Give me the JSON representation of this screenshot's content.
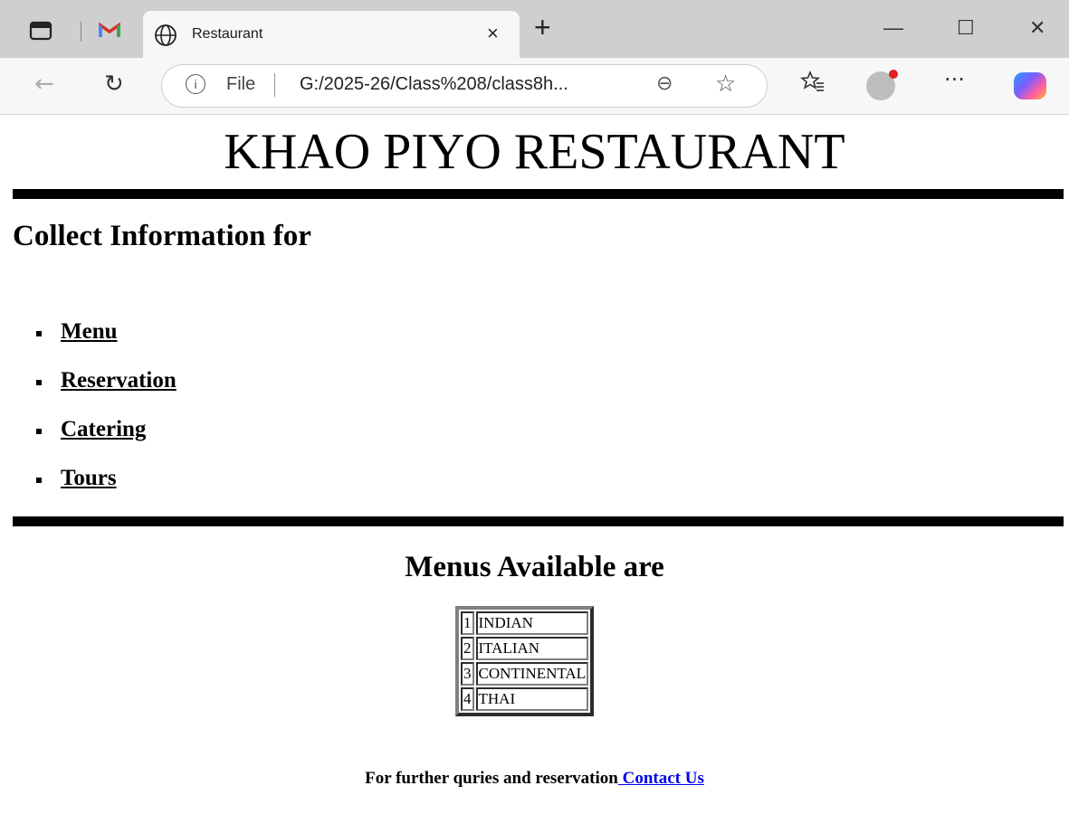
{
  "browser": {
    "tab_title": "Restaurant",
    "tab_close": "×",
    "new_tab": "+",
    "window_controls": {
      "minimize": "—",
      "maximize": "☐",
      "close": "✕"
    },
    "address_info": "i",
    "address_label": "File",
    "address_url": "G:/2025-26/Class%208/class8h...",
    "icons": [
      "sidebar-icon",
      "gmail-icon",
      "globe-icon",
      "back-icon",
      "refresh-icon",
      "zoom-out-icon",
      "favorite-star-icon",
      "favorites-list-icon",
      "profile-avatar-icon",
      "more-options-icon",
      "copilot-icon"
    ],
    "nav": {
      "back": "←",
      "refresh": "↻",
      "zoom": "⊖",
      "star": "☆",
      "favorites": "☆",
      "more": "···"
    }
  },
  "page": {
    "title": "KHAO PIYO RESTAURANT",
    "section_title": "Collect Information for",
    "links": [
      {
        "label": "Menu"
      },
      {
        "label": "Reservation"
      },
      {
        "label": "Catering"
      },
      {
        "label": "Tours"
      }
    ],
    "menus_title": "Menus Available are",
    "menu_table": [
      {
        "num": "1",
        "name": "INDIAN"
      },
      {
        "num": "2",
        "name": "ITALIAN"
      },
      {
        "num": "3",
        "name": "CONTINENTAL"
      },
      {
        "num": "4",
        "name": "THAI"
      }
    ],
    "footer_text": "For further quries and reservation",
    "footer_link": " Contact Us"
  },
  "colors": {
    "link": "#0000ee",
    "rule": "#000000",
    "tabbar": "#cfcfcf"
  }
}
